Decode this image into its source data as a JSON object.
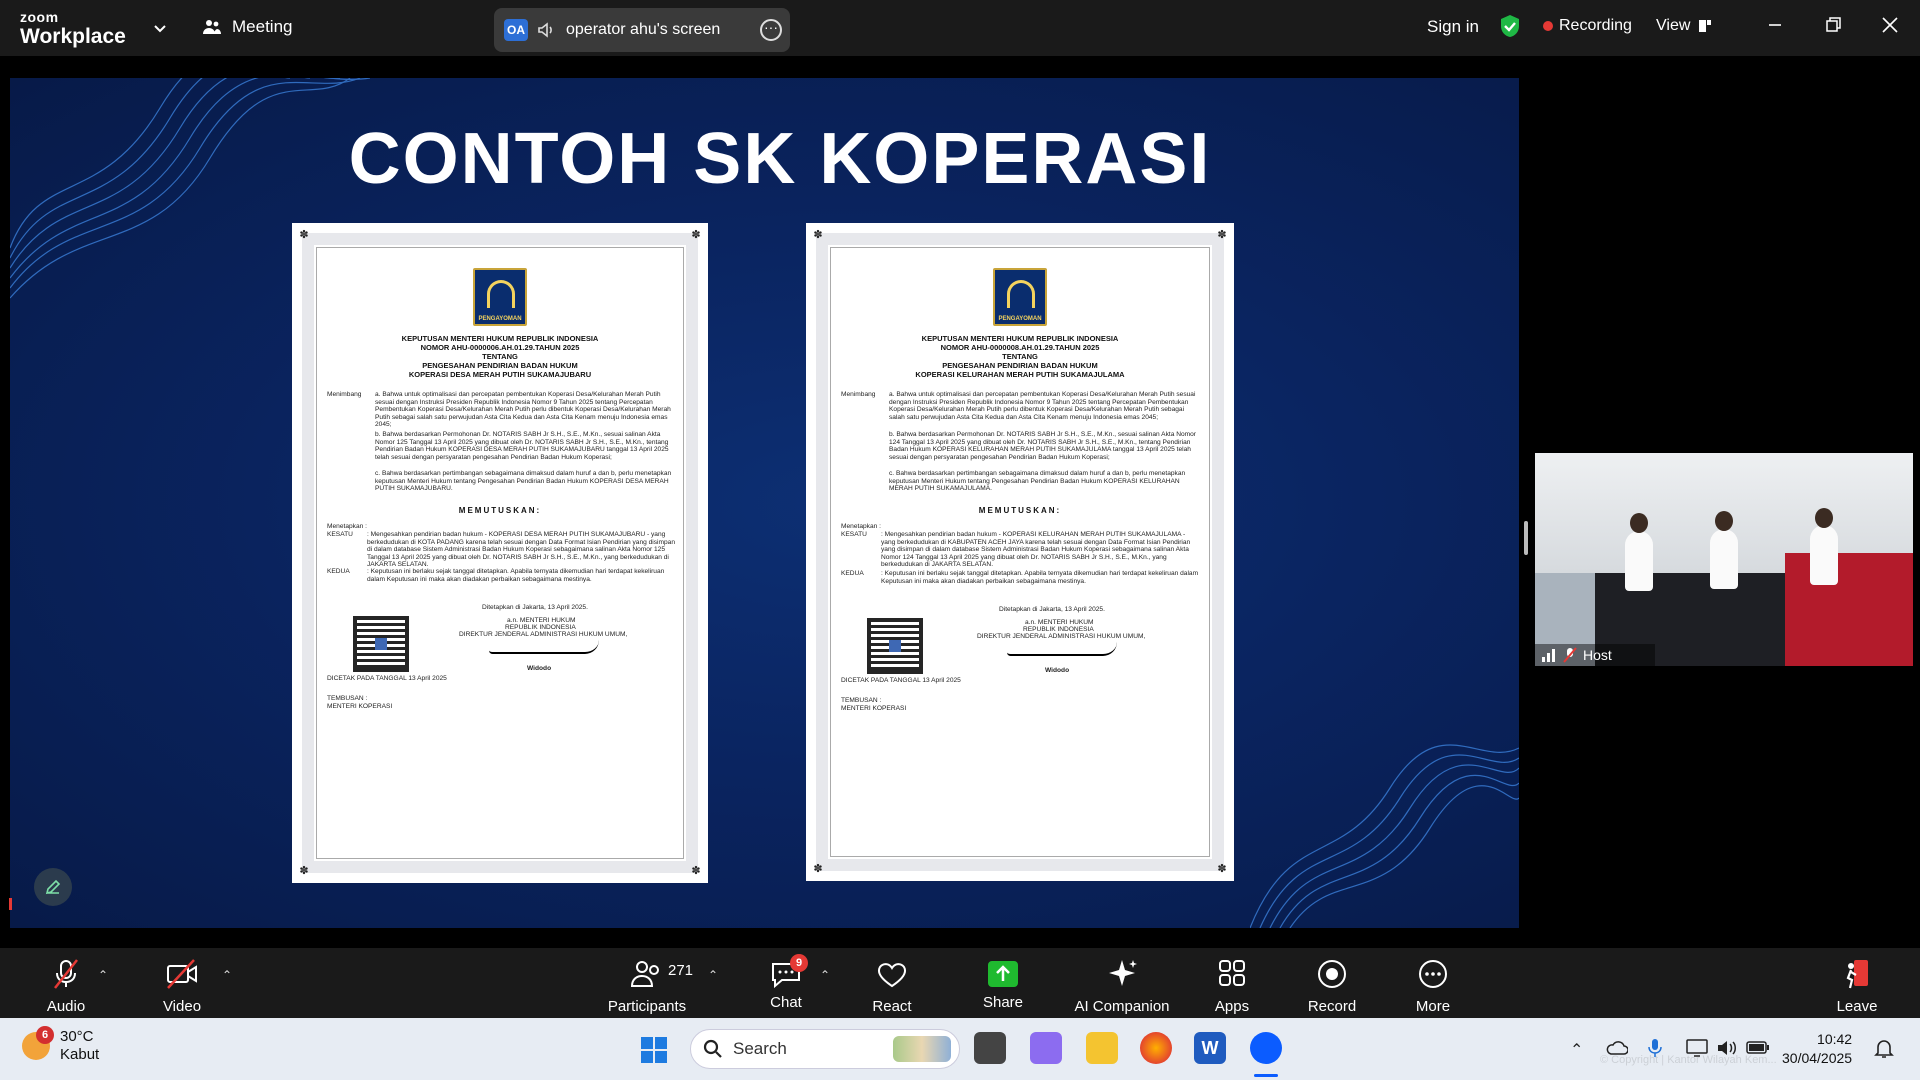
{
  "window": {
    "brand_top": "zoom",
    "brand_bottom": "Workplace",
    "meeting_label": "Meeting",
    "share_initials": "OA",
    "share_label": "operator ahu's screen",
    "sign_in": "Sign in",
    "recording": "Recording",
    "view": "View"
  },
  "slide": {
    "title": "CONTOH SK KOPERASI",
    "documents": [
      {
        "logo_text": "PENGAYOMAN",
        "h1": "KEPUTUSAN MENTERI HUKUM REPUBLIK INDONESIA",
        "h2": "NOMOR AHU-0000006.AH.01.29.TAHUN 2025",
        "h3": "TENTANG",
        "h4": "PENGESAHAN PENDIRIAN BADAN HUKUM",
        "h5": "KOPERASI DESA MERAH PUTIH SUKAMAJUBARU",
        "menimbang_label": "Menimbang",
        "menimbang_a": "a. Bahwa untuk optimalisasi dan percepatan pembentukan Koperasi Desa/Kelurahan Merah Putih sesuai dengan Instruksi Presiden Republik Indonesia Nomor 9 Tahun 2025 tentang Percepatan Pembentukan Koperasi Desa/Kelurahan Merah Putih perlu dibentuk Koperasi Desa/Kelurahan Merah Putih sebagai salah satu perwujudan Asta Cita Kedua dan Asta Cita Kenam menuju Indonesia emas 2045;",
        "menimbang_b": "b. Bahwa berdasarkan Permohonan Dr. NOTARIS SABH Jr S.H., S.E., M.Kn., sesuai salinan Akta Nomor 125 Tanggal 13 April 2025 yang dibuat oleh Dr. NOTARIS SABH Jr S.H., S.E., M.Kn., tentang Pendirian Badan Hukum KOPERASI DESA MERAH PUTIH SUKAMAJUBARU tanggal 13 April 2025 telah sesuai dengan persyaratan pengesahan Pendirian Badan Hukum Koperasi;",
        "menimbang_c": "c. Bahwa berdasarkan pertimbangan sebagaimana dimaksud dalam huruf a dan b, perlu menetapkan keputusan Menteri Hukum tentang Pengesahan Pendirian Badan Hukum KOPERASI DESA MERAH PUTIH SUKAMAJUBARU.",
        "memutuskan": "MEMUTUSKAN:",
        "menetapkan": "Menetapkan :",
        "kesatu_label": "KESATU",
        "kesatu": ": Mengesahkan pendirian badan hukum - KOPERASI DESA MERAH PUTIH SUKAMAJUBARU - yang berkedudukan di KOTA PADANG karena telah sesuai dengan Data Format Isian Pendirian yang disimpan di dalam database Sistem Administrasi Badan Hukum Koperasi sebagaimana salinan Akta Nomor 125 Tanggal 13 April 2025 yang dibuat oleh Dr. NOTARIS SABH Jr S.H., S.E., M.Kn., yang berkedudukan di JAKARTA SELATAN.",
        "kedua_label": "KEDUA",
        "kedua": ": Keputusan ini berlaku sejak tanggal ditetapkan. Apabila ternyata dikemudian hari terdapat kekeliruan dalam Keputusan ini maka akan diadakan perbaikan sebagaimana mestinya.",
        "ditetapkan": "Ditetapkan di Jakarta, 13 April 2025.",
        "sign1": "a.n. MENTERI HUKUM",
        "sign2": "REPUBLIK INDONESIA",
        "sign3": "DIREKTUR JENDERAL ADMINISTRASI HUKUM UMUM,",
        "signer": "Widodo",
        "dicetak": "DICETAK PADA TANGGAL 13 April 2025",
        "tembusan": "TEMBUSAN :",
        "tembusan_to": "MENTERI KOPERASI"
      },
      {
        "logo_text": "PENGAYOMAN",
        "h1": "KEPUTUSAN MENTERI HUKUM REPUBLIK INDONESIA",
        "h2": "NOMOR AHU-0000008.AH.01.29.TAHUN 2025",
        "h3": "TENTANG",
        "h4": "PENGESAHAN PENDIRIAN BADAN HUKUM",
        "h5": "KOPERASI KELURAHAN MERAH PUTIH SUKAMAJULAMA",
        "menimbang_label": "Menimbang",
        "menimbang_a": "a. Bahwa untuk optimalisasi dan percepatan pembentukan Koperasi Desa/Kelurahan Merah Putih sesuai dengan Instruksi Presiden Republik Indonesia Nomor 9 Tahun 2025 tentang Percepatan Pembentukan Koperasi Desa/Kelurahan Merah Putih perlu dibentuk Koperasi Desa/Kelurahan Merah Putih sebagai salah satu perwujudan Asta Cita Kedua dan Asta Cita Kenam menuju Indonesia emas 2045;",
        "menimbang_b": "b. Bahwa berdasarkan Permohonan Dr. NOTARIS SABH Jr S.H., S.E., M.Kn., sesuai salinan Akta Nomor 124 Tanggal 13 April 2025 yang dibuat oleh Dr. NOTARIS SABH Jr S.H., S.E., M.Kn., tentang Pendirian Badan Hukum KOPERASI KELURAHAN MERAH PUTIH SUKAMAJULAMA tanggal 13 April 2025 telah sesuai dengan persyaratan pengesahan Pendirian Badan Hukum Koperasi;",
        "menimbang_c": "c. Bahwa berdasarkan pertimbangan sebagaimana dimaksud dalam huruf a dan b, perlu menetapkan keputusan Menteri Hukum tentang Pengesahan Pendirian Badan Hukum KOPERASI KELURAHAN MERAH PUTIH SUKAMAJULAMA.",
        "memutuskan": "MEMUTUSKAN:",
        "menetapkan": "Menetapkan :",
        "kesatu_label": "KESATU",
        "kesatu": ": Mengesahkan pendirian badan hukum - KOPERASI KELURAHAN MERAH PUTIH SUKAMAJULAMA - yang berkedudukan di KABUPATEN ACEH JAYA karena telah sesuai dengan Data Format Isian Pendirian yang disimpan di dalam database Sistem Administrasi Badan Hukum Koperasi sebagaimana salinan Akta Nomor 124 Tanggal 13 April 2025 yang dibuat oleh Dr. NOTARIS SABH Jr S.H., S.E., M.Kn., yang berkedudukan di JAKARTA SELATAN.",
        "kedua_label": "KEDUA",
        "kedua": ": Keputusan ini berlaku sejak tanggal ditetapkan. Apabila ternyata dikemudian hari terdapat kekeliruan dalam Keputusan ini maka akan diadakan perbaikan sebagaimana mestinya.",
        "ditetapkan": "Ditetapkan di Jakarta, 13 April 2025.",
        "sign1": "a.n. MENTERI HUKUM",
        "sign2": "REPUBLIK INDONESIA",
        "sign3": "DIREKTUR JENDERAL ADMINISTRASI HUKUM UMUM,",
        "signer": "Widodo",
        "dicetak": "DICETAK PADA TANGGAL 13 April 2025",
        "tembusan": "TEMBUSAN :",
        "tembusan_to": "MENTERI KOPERASI"
      }
    ]
  },
  "video": {
    "host_label": "Host"
  },
  "toolbar": {
    "audio": "Audio",
    "video": "Video",
    "participants": "Participants",
    "participants_count": "271",
    "chat": "Chat",
    "chat_badge": "9",
    "react": "React",
    "share": "Share",
    "ai_companion": "AI Companion",
    "apps": "Apps",
    "record": "Record",
    "more": "More",
    "leave": "Leave"
  },
  "taskbar": {
    "weather_badge": "6",
    "temperature": "30°C",
    "weather_desc": "Kabut",
    "search_placeholder": "Search",
    "time": "10:42",
    "date": "30/04/2025",
    "watermark": "© Copyright | Kantor Wilayah Kem..."
  },
  "colors": {
    "accent_blue": "#0b5cff",
    "recording_red": "#e53935",
    "share_green": "#1fba2f",
    "slide_bg": "#0a2460"
  }
}
